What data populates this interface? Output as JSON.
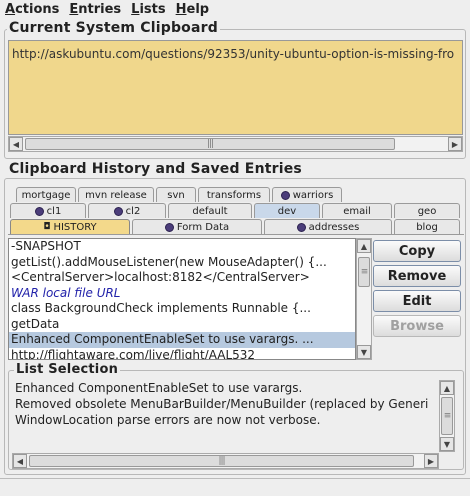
{
  "menubar": {
    "items": [
      {
        "label_ul": "A",
        "label_rest": "ctions"
      },
      {
        "label_ul": "E",
        "label_rest": "ntries"
      },
      {
        "label_ul": "L",
        "label_rest": "ists"
      },
      {
        "label_ul": "H",
        "label_rest": "elp"
      }
    ]
  },
  "clipboard": {
    "title": "Current System Clipboard",
    "value": "http://askubuntu.com/questions/92353/unity-ubuntu-option-is-missing-fro"
  },
  "history": {
    "title": "Clipboard History and Saved Entries",
    "tabs_row1": [
      "mortgage",
      "mvn release",
      "svn",
      "transforms",
      "warriors"
    ],
    "tabs_row2": [
      "cl1",
      "cl2",
      "default",
      "dev",
      "email",
      "geo"
    ],
    "tabs_row3": [
      "HISTORY",
      "Form Data",
      "addresses",
      "blog"
    ],
    "entries": [
      "-SNAPSHOT",
      "getList().addMouseListener(new MouseAdapter() {...",
      "<CentralServer>localhost:8182</CentralServer>",
      "WAR local file URL",
      "class BackgroundCheck implements Runnable {...",
      "getData",
      "Enhanced ComponentEnableSet to use varargs.  ...",
      "http://flightaware.com/live/flight/AAL532"
    ],
    "selected_index": 6,
    "buttons": {
      "copy": "Copy",
      "remove": "Remove",
      "edit": "Edit",
      "browse": "Browse"
    }
  },
  "list_selection": {
    "title": "List Selection",
    "lines": [
      "Enhanced ComponentEnableSet to use varargs.",
      "Removed obsolete MenuBarBuilder/MenuBuilder (replaced by Generi",
      "WindowLocation parse errors are now not verbose."
    ]
  },
  "colors": {
    "clipboard_bg": "#f0d78c",
    "history_tab": "#f3d98b",
    "selected_row": "#b6c9df",
    "link_text": "#2222aa"
  }
}
